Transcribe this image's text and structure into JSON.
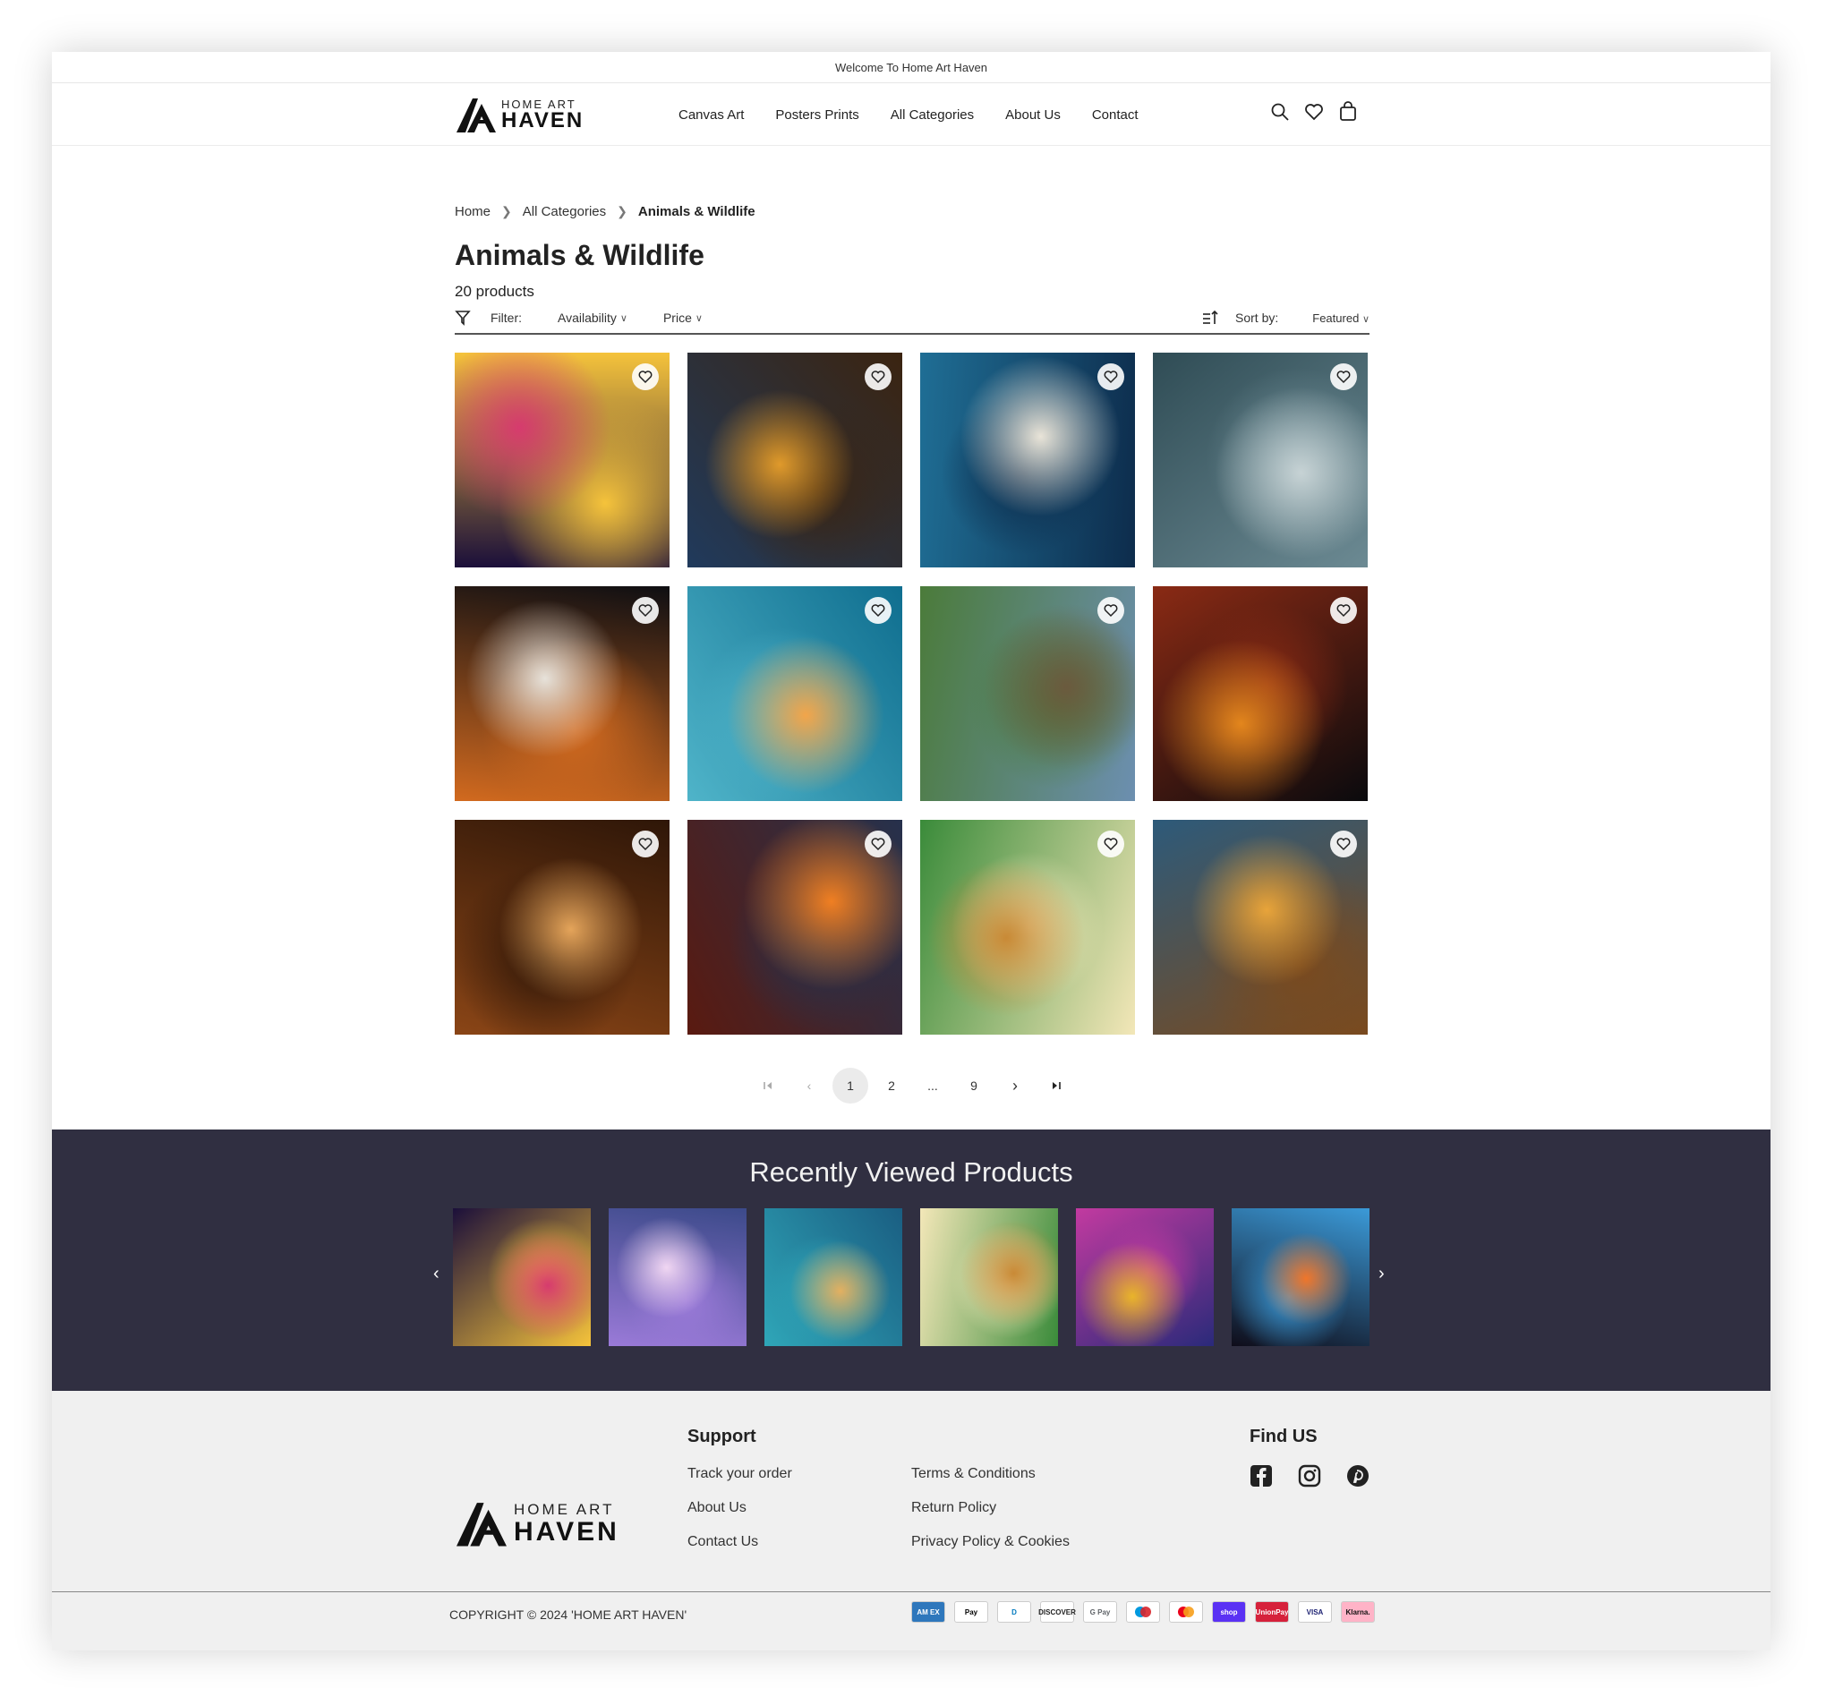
{
  "announcement": "Welcome To Home Art Haven",
  "brand": {
    "line1": "HOME ART",
    "line2": "HAVEN"
  },
  "nav": [
    "Canvas Art",
    "Posters Prints",
    "All Categories",
    "About Us",
    "Contact"
  ],
  "header_icons": [
    "search-icon",
    "heart-icon",
    "cart-icon"
  ],
  "breadcrumb": [
    "Home",
    "All Categories",
    "Animals & Wildlife"
  ],
  "page_title": "Animals & Wildlife",
  "product_count": "20 products",
  "filter": {
    "label": "Filter:",
    "availability": "Availability",
    "price": "Price"
  },
  "sort": {
    "label": "Sort by:",
    "value": "Featured"
  },
  "products": [
    {
      "c1": "#1b0f3a",
      "c2": "#d63b6e",
      "c3": "#f5c33b"
    },
    {
      "c1": "#203a5c",
      "c2": "#e09a2b",
      "c3": "#3b2410"
    },
    {
      "c1": "#1f6e95",
      "c2": "#e9e4d8",
      "c3": "#0d2c4c"
    },
    {
      "c1": "#2f4c55",
      "c2": "#c7d3d5",
      "c3": "#6c8a93"
    },
    {
      "c1": "#0e0e12",
      "c2": "#e7e2da",
      "c3": "#d26a1f"
    },
    {
      "c1": "#0f6e8f",
      "c2": "#f2a54a",
      "c3": "#4fb4c9"
    },
    {
      "c1": "#6c8fb0",
      "c2": "#6b5a3e",
      "c3": "#4b7b3a"
    },
    {
      "c1": "#0a0a0d",
      "c2": "#e3861d",
      "c3": "#8a2a14"
    },
    {
      "c1": "#8a4516",
      "c2": "#e4a45a",
      "c3": "#2e1608"
    },
    {
      "c1": "#5a1a10",
      "c2": "#f07f22",
      "c3": "#26314c"
    },
    {
      "c1": "#3a8b3a",
      "c2": "#c98a36",
      "c3": "#f3e7b8"
    },
    {
      "c1": "#2d5a7a",
      "c2": "#e8a43a",
      "c3": "#7a4a1e"
    }
  ],
  "pagination": {
    "pages": [
      "1",
      "2",
      "...",
      "9"
    ],
    "current": "1"
  },
  "recent": {
    "title": "Recently Viewed Products",
    "items": [
      {
        "c1": "#1b0f3a",
        "c2": "#d63b6e",
        "c3": "#f5c33b"
      },
      {
        "c1": "#3c4a8a",
        "c2": "#f0d6f2",
        "c3": "#9a7ad8"
      },
      {
        "c1": "#1a5e82",
        "c2": "#e3b060",
        "c3": "#2fa6b8"
      },
      {
        "c1": "#3a8b3a",
        "c2": "#c98a36",
        "c3": "#f3e7b8"
      },
      {
        "c1": "#2a2a7a",
        "c2": "#e9b42a",
        "c3": "#c23aa0"
      },
      {
        "c1": "#0f0d1a",
        "c2": "#f0762a",
        "c3": "#3b9ad8"
      }
    ]
  },
  "footer": {
    "support_title": "Support",
    "col1": [
      "Track your order",
      "About Us",
      "Contact Us"
    ],
    "col2": [
      "Terms & Conditions",
      "Return Policy",
      "Privacy Policy & Cookies"
    ],
    "find_title": "Find US",
    "social": [
      "facebook-icon",
      "instagram-icon",
      "pinterest-icon"
    ],
    "copyright": "COPYRIGHT © 2024 'HOME ART HAVEN'",
    "payments": [
      {
        "label": "AM EX",
        "bg": "#2e77bc",
        "fg": "#ffffff"
      },
      {
        "label": "Pay",
        "bg": "#ffffff",
        "fg": "#000000"
      },
      {
        "label": "D",
        "bg": "#ffffff",
        "fg": "#0079be"
      },
      {
        "label": "DISCOVER",
        "bg": "#ffffff",
        "fg": "#222222"
      },
      {
        "label": "G Pay",
        "bg": "#ffffff",
        "fg": "#5f6368"
      },
      {
        "label": "",
        "bg": "#ffffff",
        "fg": "#000000"
      },
      {
        "label": "",
        "bg": "#ffffff",
        "fg": "#000000"
      },
      {
        "label": "shop",
        "bg": "#5a31f4",
        "fg": "#ffffff"
      },
      {
        "label": "UnionPay",
        "bg": "#d6213b",
        "fg": "#ffffff"
      },
      {
        "label": "VISA",
        "bg": "#ffffff",
        "fg": "#1a1f71"
      },
      {
        "label": "Klarna.",
        "bg": "#ffb3c7",
        "fg": "#111111"
      }
    ]
  }
}
